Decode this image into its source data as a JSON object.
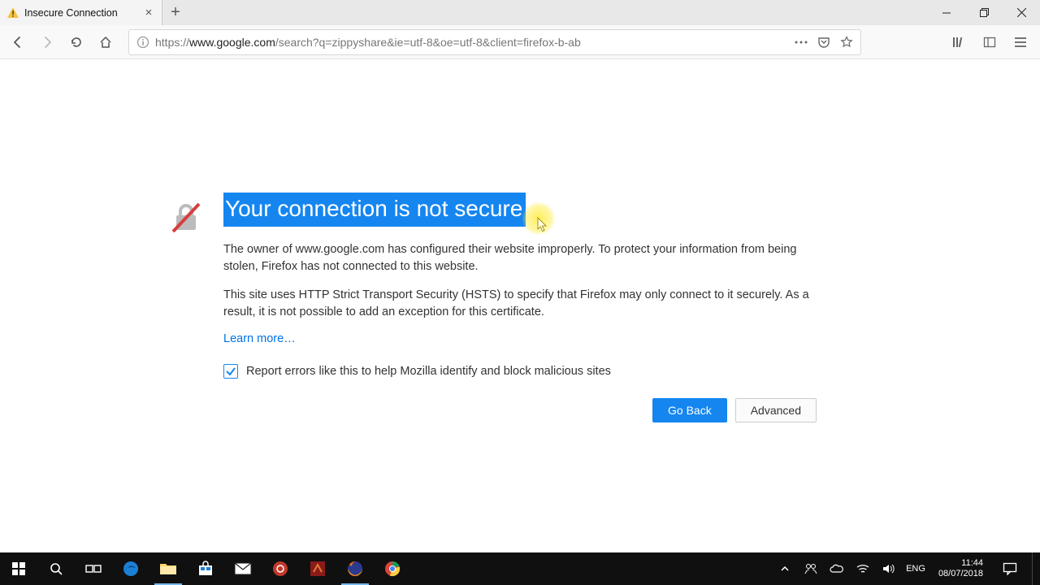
{
  "window": {
    "tab_title": "Insecure Connection"
  },
  "urlbar": {
    "proto": "https://",
    "host": "www.google.com",
    "path": "/search?q=zippyshare&ie=utf-8&oe=utf-8&client=firefox-b-ab"
  },
  "error": {
    "heading": "Your connection is not secure",
    "para1": "The owner of www.google.com has configured their website improperly. To protect your information from being stolen, Firefox has not connected to this website.",
    "para2": "This site uses HTTP Strict Transport Security (HSTS) to specify that Firefox may only connect to it securely. As a result, it is not possible to add an exception for this certificate.",
    "learn_more": "Learn more…",
    "report_label": "Report errors like this to help Mozilla identify and block malicious sites",
    "go_back": "Go Back",
    "advanced": "Advanced"
  },
  "taskbar": {
    "lang": "ENG",
    "time": "11:44",
    "date": "08/07/2018"
  }
}
